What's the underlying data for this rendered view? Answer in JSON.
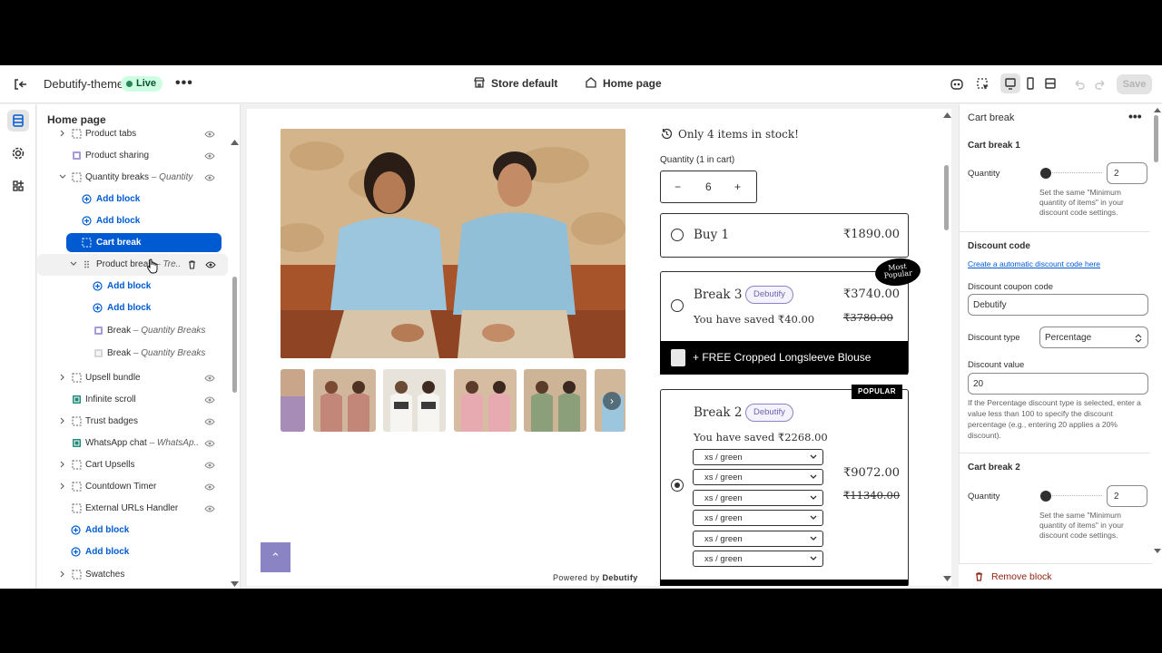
{
  "topbar": {
    "theme_name": "Debutify-theme",
    "status": "Live",
    "more": "•••",
    "store_selector": "Store default",
    "page_selector": "Home page",
    "save_label": "Save"
  },
  "sidebar": {
    "title": "Home page",
    "items": [
      {
        "label": "Product tabs"
      },
      {
        "label": "Product sharing"
      },
      {
        "label": "Quantity breaks",
        "suffix": " – Quantity"
      },
      {
        "label": "Add block"
      },
      {
        "label": "Add block"
      },
      {
        "label": "Cart break"
      },
      {
        "label": "Product break",
        "suffix": " – Tre..."
      },
      {
        "label": "Add block"
      },
      {
        "label": "Add block"
      },
      {
        "label": "Break",
        "suffix": " – Quantity Breaks"
      },
      {
        "label": "Break",
        "suffix": " – Quantity Breaks"
      },
      {
        "label": "Upsell bundle"
      },
      {
        "label": "Infinite scroll"
      },
      {
        "label": "Trust badges"
      },
      {
        "label": "WhatsApp chat",
        "suffix": " – WhatsAp..."
      },
      {
        "label": "Cart Upsells"
      },
      {
        "label": "Countdown Timer"
      },
      {
        "label": "External URLs Handler"
      },
      {
        "label": "Add block"
      },
      {
        "label": "Add block"
      },
      {
        "label": "Swatches"
      }
    ]
  },
  "preview": {
    "stock": "Only 4 items in stock!",
    "quantity_label": "Quantity (1 in cart)",
    "quantity_value": "6",
    "qty_minus": "−",
    "qty_plus": "+",
    "offers": [
      {
        "title": "Buy 1",
        "price": "₹1890.00"
      },
      {
        "title": "Break 3",
        "badge": "Debutify",
        "price": "₹3740.00",
        "compare": "₹3780.00",
        "saved": "You have saved ₹40.00",
        "ribbon": "Most Popular",
        "gift": "+ FREE Cropped Longsleeve Blouse"
      },
      {
        "title": "Break 2",
        "badge": "Debutify",
        "price": "₹9072.00",
        "compare": "₹11340.00",
        "saved": "You have saved ₹2268.00",
        "tag": "POPULAR",
        "variants": [
          "xs / green",
          "xs / green",
          "xs / green",
          "xs / green",
          "xs / green",
          "xs / green"
        ]
      }
    ],
    "back_to_top": "⌃",
    "powered_prefix": "Powered by ",
    "powered_brand": "Debutify"
  },
  "panel": {
    "title": "Cart break",
    "more": "•••",
    "cart_break_1": "Cart break 1",
    "quantity_label": "Quantity",
    "quantity_1": "2",
    "quantity_help": "Set the same \"Minimum quantity of items\" in your discount code settings.",
    "discount_code_heading": "Discount code",
    "discount_link": "Create a automatic discount code here",
    "coupon_label": "Discount coupon code",
    "coupon_value": "Debutify",
    "type_label": "Discount type",
    "type_value": "Percentage",
    "value_label": "Discount value",
    "value_value": "20",
    "value_help": "If the Percentage discount type is selected, enter a value less than 100 to specify the discount percentage (e.g., entering 20 applies a 20% discount).",
    "cart_break_2": "Cart break 2",
    "quantity_2": "2",
    "remove_label": "Remove block"
  }
}
